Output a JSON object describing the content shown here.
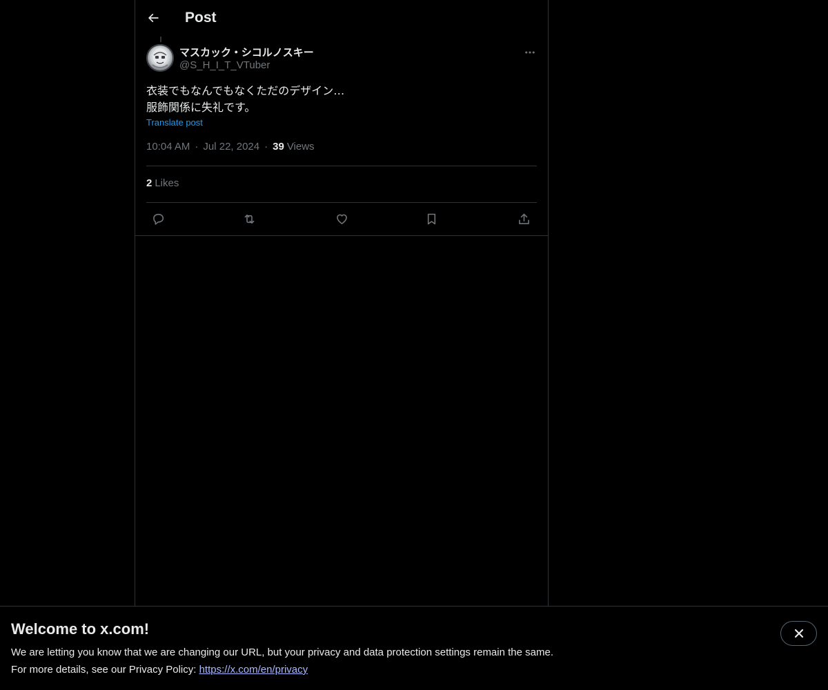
{
  "header": {
    "title": "Post",
    "back_icon": "arrow-left-icon"
  },
  "post": {
    "author": {
      "name": "マスカック・シコルノスキー",
      "handle": "@S_H_I_T_VTuber",
      "avatar_icon": "avatar-image"
    },
    "more_icon": "ellipsis-icon",
    "text_lines": [
      "衣装でもなんでもなくただのデザイン…",
      "服飾関係に失礼です。"
    ],
    "translate_label": "Translate post",
    "time": "10:04 AM",
    "separator": "·",
    "date": "Jul 22, 2024",
    "views_count": "39",
    "views_label": "Views",
    "likes_count": "2",
    "likes_label": "Likes"
  },
  "actions": [
    {
      "name": "reply",
      "icon": "reply-icon"
    },
    {
      "name": "repost",
      "icon": "repost-icon"
    },
    {
      "name": "like",
      "icon": "heart-icon"
    },
    {
      "name": "bookmark",
      "icon": "bookmark-icon"
    },
    {
      "name": "share",
      "icon": "share-icon"
    }
  ],
  "banner": {
    "title": "Welcome to x.com!",
    "line1": "We are letting you know that we are changing our URL, but your privacy and data protection settings remain the same.",
    "line2_prefix": "For more details, see our Privacy Policy: ",
    "link_text": "https://x.com/en/privacy",
    "close_icon": "close-icon"
  },
  "colors": {
    "background": "#000000",
    "text": "#e7e9ea",
    "secondary_text": "#71767b",
    "accent": "#1d9bf0",
    "border": "#2f3336"
  }
}
